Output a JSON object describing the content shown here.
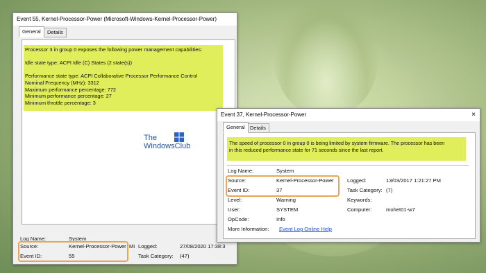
{
  "brand": {
    "line1": "The",
    "line2": "WindowsClub"
  },
  "win1": {
    "title": "Event 55, Kernel-Processor-Power (Microsoft-Windows-Kernel-Processor-Power)",
    "tabs": [
      "General",
      "Details"
    ],
    "lines": [
      "Processor 3 in group 0 exposes the following power management capabilities:",
      "",
      "Idle state type: ACPI Idle (C) States (2 state(s))",
      "",
      "Performance state type: ACPI Collaborative Processor Performance Control",
      "Nominal Frequency (MHz): 3312",
      "Maximum performance percentage: 772",
      "Minimum performance percentage: 27",
      "Minimum throttle percentage: 3"
    ],
    "log_name_label": "Log Name:",
    "log_name": "System",
    "source_label": "Source:",
    "source": "Kernel-Processor-Power",
    "source_cut": "Mi",
    "logged_label": "Logged:",
    "logged": "27/08/2020 17:38:3",
    "event_id_label": "Event ID:",
    "event_id": "55",
    "task_label": "Task Category:",
    "task": "(47)"
  },
  "win2": {
    "title": "Event 37, Kernel-Processor-Power",
    "close": "×",
    "tabs": [
      "General",
      "Details"
    ],
    "lines": [
      "The speed of processor 0 in group 0 is being limited by system firmware. The processor has been",
      "in this reduced performance state for 71 seconds since the last report."
    ],
    "fields": {
      "log_name_label": "Log Name:",
      "log_name": "System",
      "source_label": "Source:",
      "source": "Kernel-Processor-Power",
      "logged_label": "Logged:",
      "logged": "13/03/2017 1:21:27 PM",
      "event_id_label": "Event ID:",
      "event_id": "37",
      "task_label": "Task Category:",
      "task": "(7)",
      "level_label": "Level:",
      "level": "Warning",
      "keywords_label": "Keywords:",
      "keywords": "",
      "user_label": "User:",
      "user": "SYSTEM",
      "computer_label": "Computer:",
      "computer": "mohet01-w7",
      "opcode_label": "OpCode:",
      "opcode": "Info",
      "more_label": "More Information:",
      "more_link": "Event Log Online Help"
    }
  },
  "colors": {
    "highlight": "#e0ee5c",
    "ring": "#e8a553",
    "link": "#1a4fd6"
  }
}
